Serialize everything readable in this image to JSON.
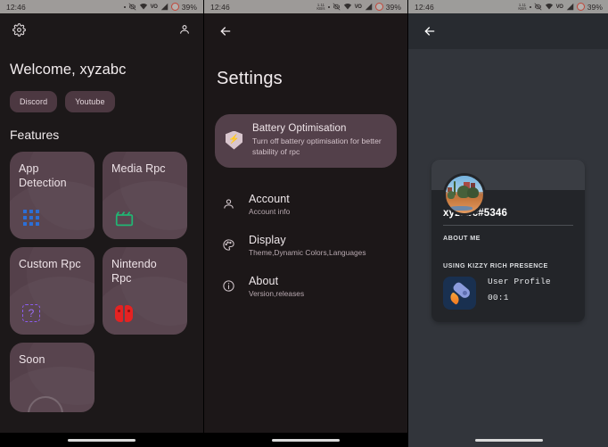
{
  "statusbar": {
    "time": "12:46",
    "battery_percent": "39%",
    "net_speed": "1.11",
    "net_unit": "KB/s",
    "vo_label": "VO",
    "icons": [
      "net-speed-icon",
      "dot-icon",
      "vibrate-off-icon",
      "wifi-icon",
      "volte-icon",
      "signal-icon",
      "battery-saver-icon"
    ]
  },
  "home": {
    "settings_icon": "gear-icon",
    "account_icon": "person-icon",
    "welcome": "Welcome, xyzabc",
    "chips": [
      {
        "label": "Discord"
      },
      {
        "label": "Youtube"
      }
    ],
    "section_title": "Features",
    "cards": [
      {
        "title": "App Detection",
        "icon": "app-grid-icon"
      },
      {
        "title": "Media Rpc",
        "icon": "clapperboard-icon"
      },
      {
        "title": "Custom Rpc",
        "icon": "question-box-icon"
      },
      {
        "title": "Nintendo Rpc",
        "icon": "nintendo-switch-icon"
      },
      {
        "title": "Soon",
        "icon": "arc-icon"
      }
    ]
  },
  "settings": {
    "back_icon": "back-arrow-icon",
    "title": "Settings",
    "highlight_card": {
      "icon": "shield-bolt-icon",
      "title": "Battery Optimisation",
      "subtitle": "Turn off battery optimisation for better stability of rpc"
    },
    "items": [
      {
        "icon": "person-icon",
        "title": "Account",
        "subtitle": "Account info"
      },
      {
        "icon": "palette-icon",
        "title": "Display",
        "subtitle": "Theme,Dynamic Colors,Languages"
      },
      {
        "icon": "info-icon",
        "title": "About",
        "subtitle": "Version,releases"
      }
    ]
  },
  "profile": {
    "back_icon": "back-arrow-icon",
    "avatar": "desert-landscape-avatar",
    "username": "xyzabc#5346",
    "about_me_label": "ABOUT ME",
    "presence_label": "USING KIZZY RICH PRESENCE",
    "presence": {
      "icon": "rocket-icon",
      "title": "User Profile",
      "time": "00:1"
    }
  },
  "colors": {
    "home_bg": "#1c1819",
    "card_bg": "#54404a",
    "chip_bg": "#4c3841",
    "profile_bg": "#32353b",
    "profile_card_bg": "#232529",
    "accent_blue": "#2b6fd8",
    "accent_green": "#22b573",
    "accent_red": "#e52222",
    "accent_purple": "#8b5cf0",
    "battery_red": "#c1463a"
  }
}
